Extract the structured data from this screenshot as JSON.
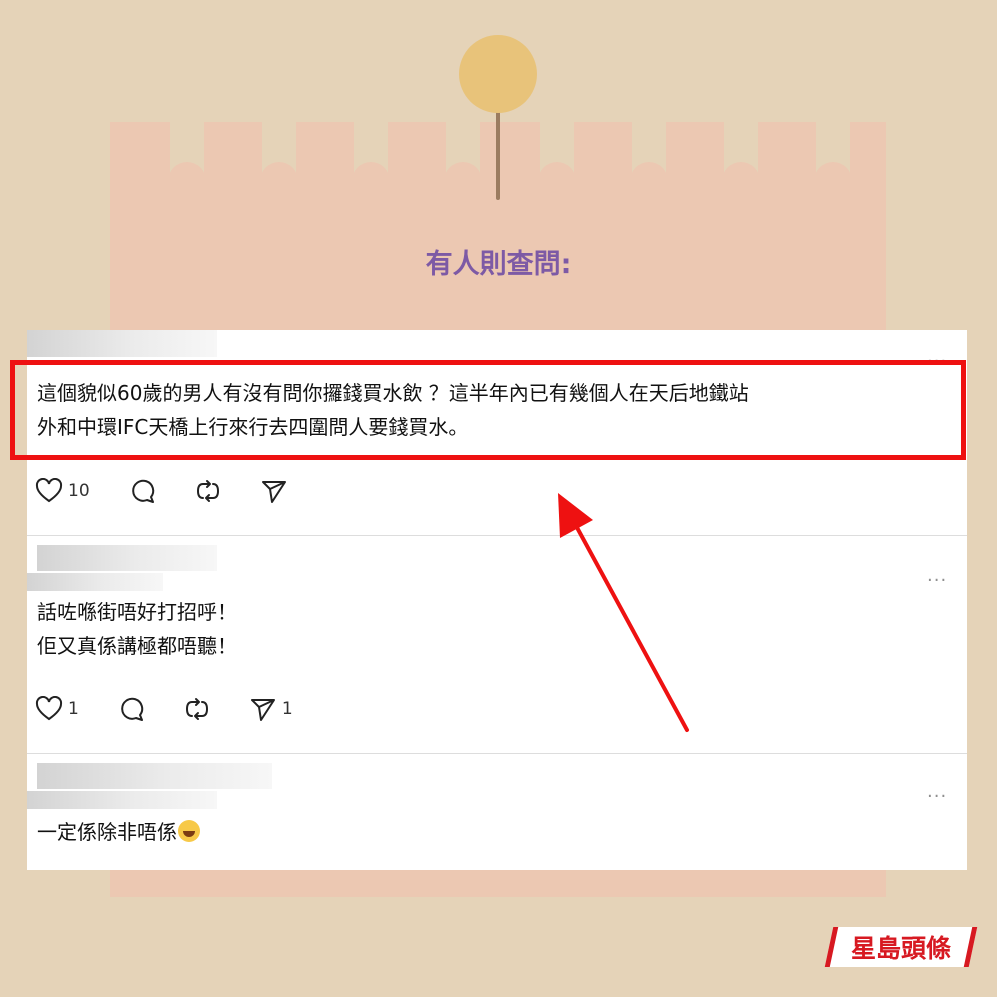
{
  "headline": "有人則查問:",
  "posts": [
    {
      "text_lines": [
        "這個貌似60歲的男人有沒有問你攞錢買水飲 ？這半年內已有幾個人在天后地鐵站",
        "外和中環IFC天橋上行來行去四圍問人要錢買水。"
      ],
      "like_count": "10",
      "share_count": ""
    },
    {
      "text_lines": [
        "話咗喺街唔好打招呼！",
        "佢又真係講極都唔聽！"
      ],
      "like_count": "1",
      "share_count": "1"
    },
    {
      "text_lines": [
        "一定係除非唔係"
      ],
      "emoji": "face-with-tears-of-joy-icon"
    }
  ],
  "more_label": "...",
  "logo_text": "星島頭條",
  "colors": {
    "background": "#e5d3b8",
    "paper": "#ecc8b2",
    "pin": "#e8c37a",
    "headline": "#7d5aa5",
    "highlight": "#ee1111",
    "logo_red": "#d71921"
  },
  "icons": [
    "heart-icon",
    "comment-icon",
    "repost-icon",
    "send-icon",
    "more-icon",
    "pin-icon",
    "arrow-icon"
  ]
}
